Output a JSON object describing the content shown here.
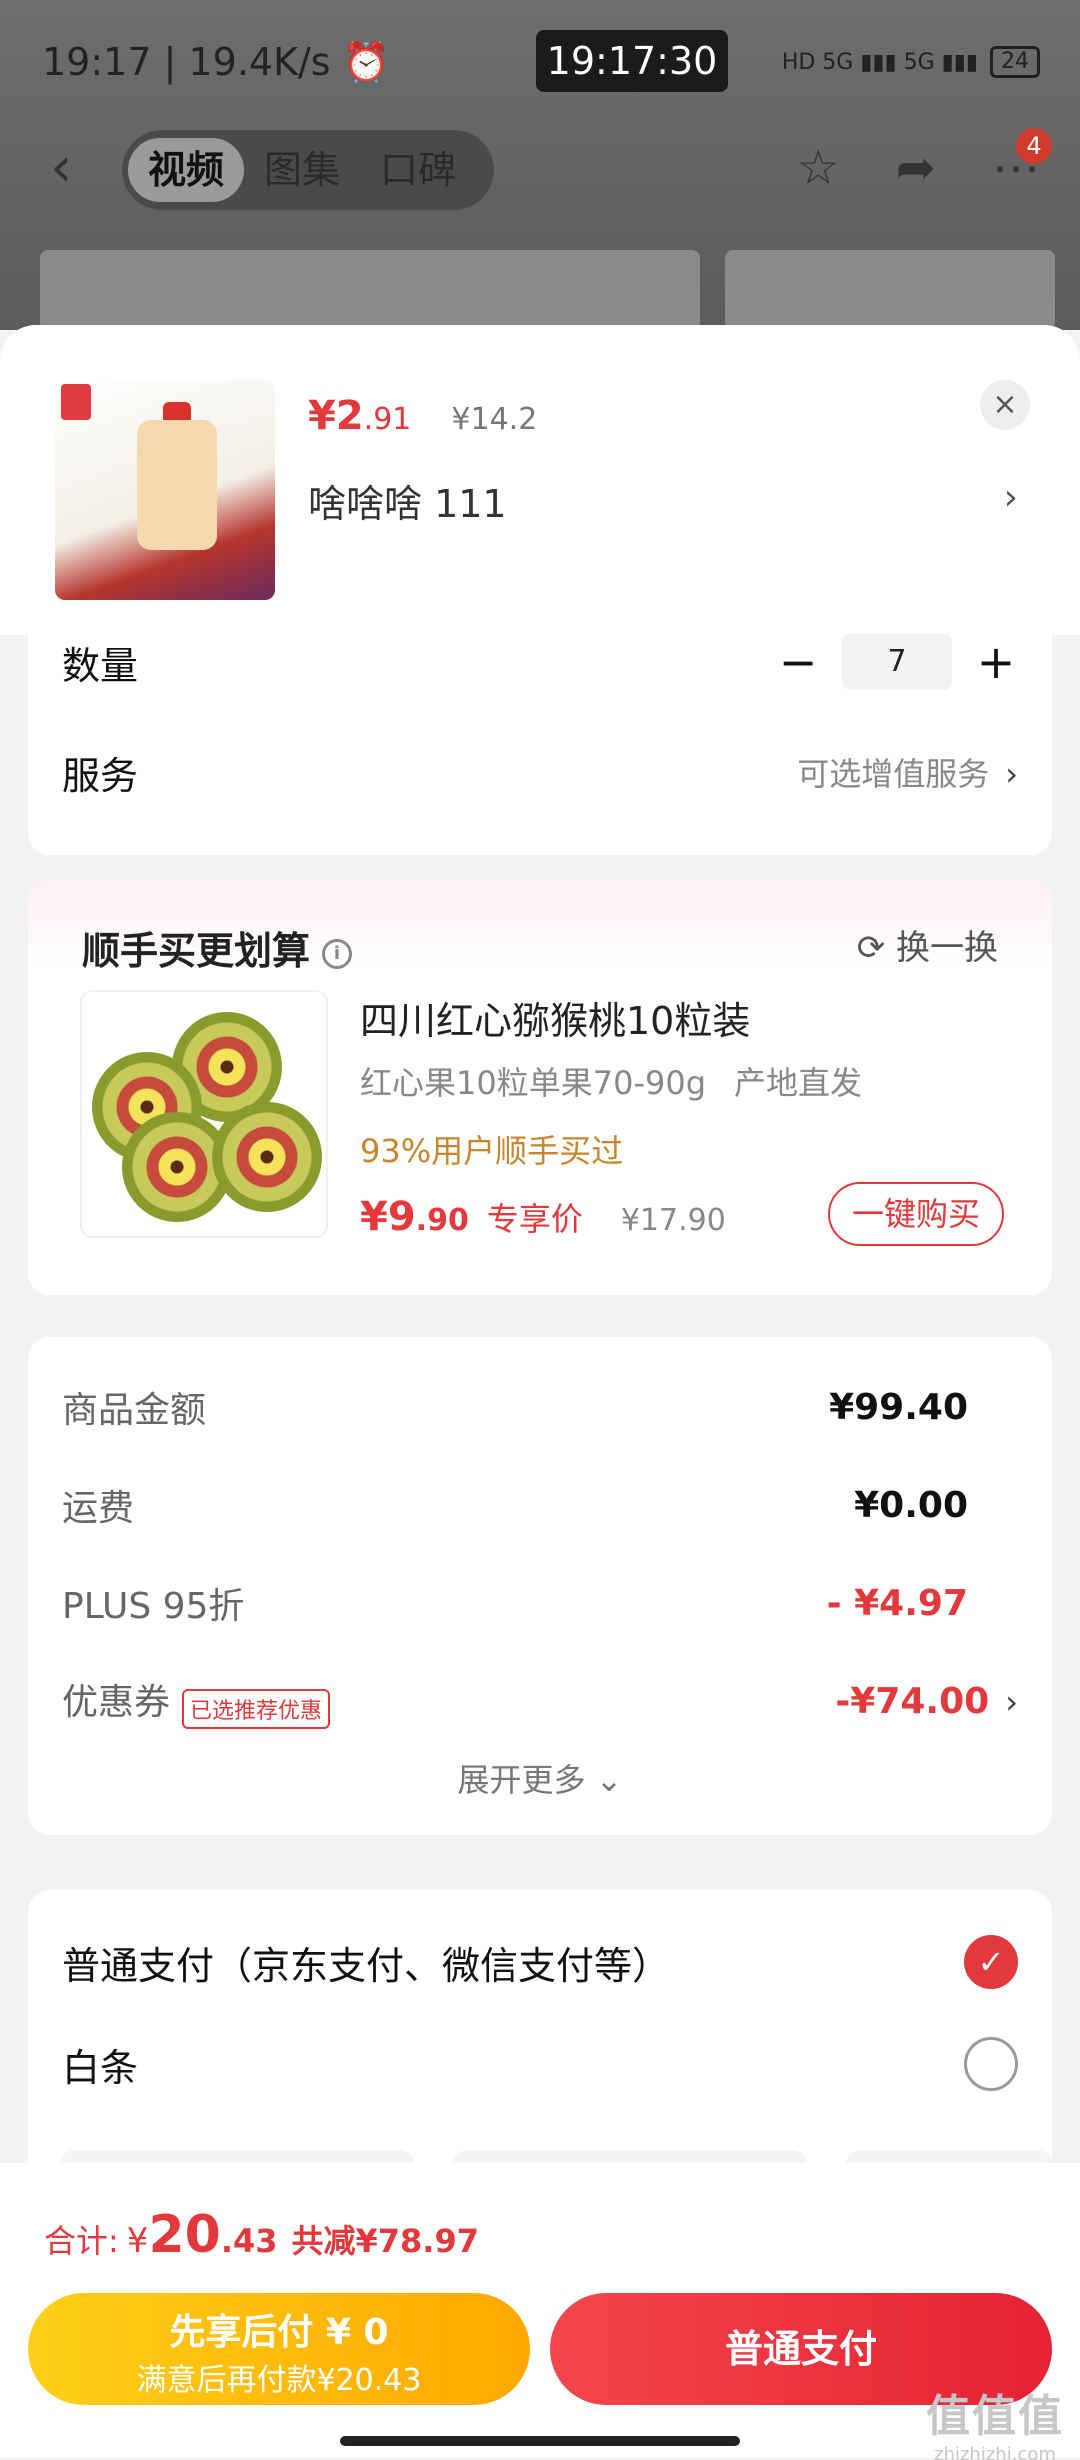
{
  "status": {
    "left": "19:17 | 19.4K/s ⏰",
    "clock": "19:17:30",
    "network": "HD 5G ▮▮▮ 5G ▮▮▮",
    "battery": "24"
  },
  "nav": {
    "back": "‹",
    "tabs": [
      "视频",
      "图集",
      "口碑"
    ],
    "badge": "4"
  },
  "product": {
    "price_int": "¥2",
    "price_dec": ".91",
    "price_old": "¥14.2",
    "variant": "啥啥啥  111",
    "close": "×"
  },
  "quantity": {
    "label": "数量",
    "minus": "−",
    "value": "7",
    "plus": "+"
  },
  "service": {
    "label": "服务",
    "hint": "可选增值服务",
    "chev": "›"
  },
  "bundle": {
    "title": "顺手买更划算",
    "info": "i",
    "refresh": "⟳ 换一换",
    "name": "四川红心猕猴桃10粒装",
    "spec1": "红心果10粒单果70-90g",
    "spec2": "产地直发",
    "pct": "93%用户顺手买过",
    "price_int": "¥9",
    "price_dec": ".90",
    "tag": "专享价",
    "old": "¥17.90",
    "buy": "一键购买"
  },
  "summary": {
    "goods_label": "商品金额",
    "goods_value": "¥99.40",
    "ship_label": "运费",
    "ship_value": "¥0.00",
    "plus_label": "PLUS 95折",
    "plus_value": "- ¥4.97",
    "coupon_label": "优惠券",
    "coupon_tag": "已选推荐优惠",
    "coupon_value": "-¥74.00",
    "coupon_chev": "›",
    "expand": "展开更多 ⌄"
  },
  "payment": {
    "normal": "普通支付（京东支付、微信支付等）",
    "baitiao": "白条",
    "check": "✓"
  },
  "footer": {
    "total_label": "合计:",
    "total_cur": "¥",
    "total_int": "20",
    "total_dec": ".43",
    "save": "共减¥78.97",
    "later_l1": "先享后付 ¥ 0",
    "later_l2": "满意后再付款¥20.43",
    "pay": "普通支付"
  },
  "watermark": {
    "line1": "值值值",
    "line2": "zhizhizhi.com"
  }
}
